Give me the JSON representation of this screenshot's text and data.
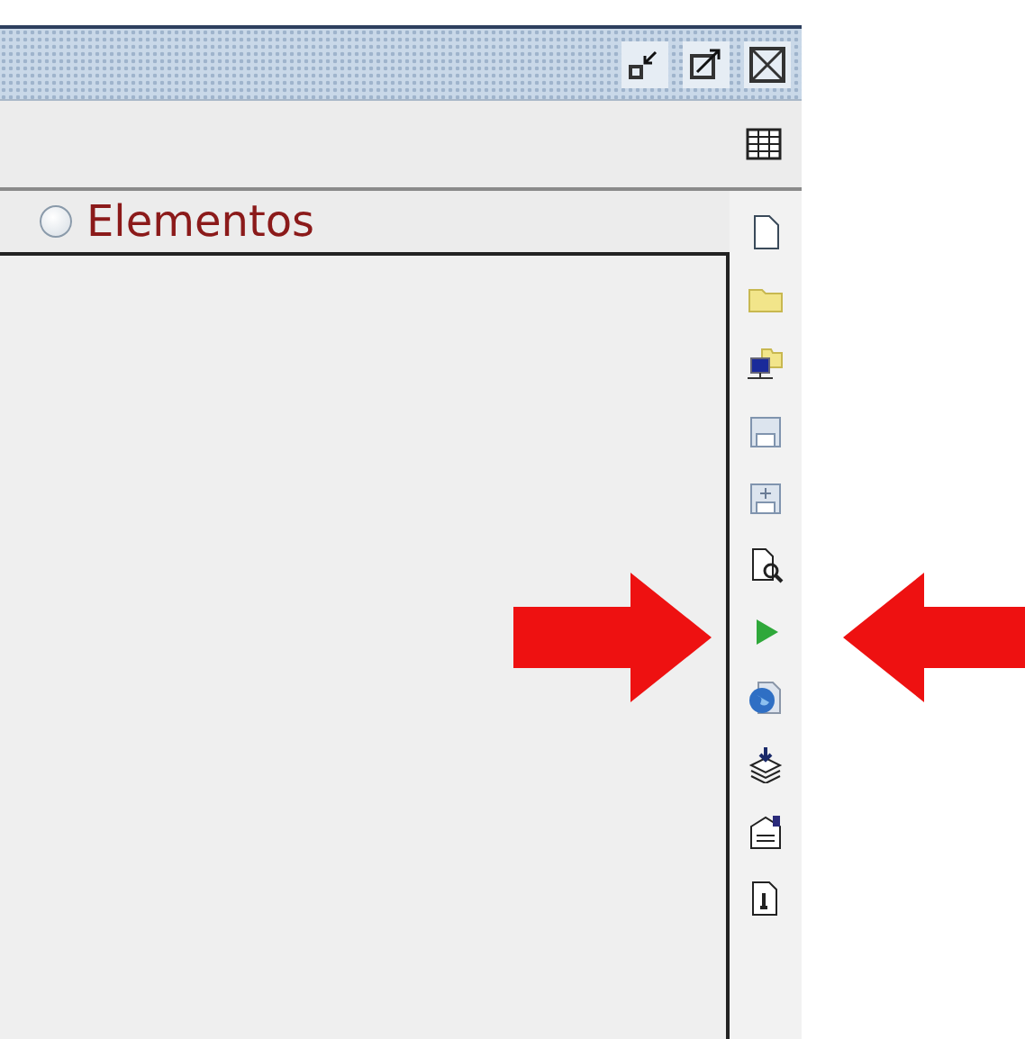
{
  "panel": {
    "title": "Elementos",
    "selected": false
  }
}
